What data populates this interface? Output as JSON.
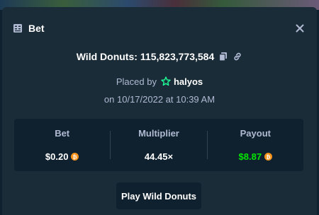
{
  "modal": {
    "title": "Bet",
    "close_icon": "close-icon"
  },
  "game": {
    "name": "Wild Donuts",
    "separator": ":",
    "bet_id": "115,823,773,584",
    "copy_icon": "copy-icon",
    "link_icon": "link-icon"
  },
  "placed": {
    "prefix": "Placed by",
    "user_icon": "star-badge-icon",
    "username": "halyos",
    "datetime": "on 10/17/2022 at 10:39 AM"
  },
  "stats": {
    "bet": {
      "label": "Bet",
      "value": "$0.20",
      "currency_icon": "bitcoin-icon"
    },
    "multiplier": {
      "label": "Multiplier",
      "value": "44.45×"
    },
    "payout": {
      "label": "Payout",
      "value": "$8.87",
      "currency_icon": "bitcoin-icon"
    }
  },
  "actions": {
    "play_label": "Play Wild Donuts"
  },
  "colors": {
    "background": "#0f212e",
    "panel": "#1a2c38",
    "muted_text": "#b1bad3",
    "payout_green": "#00e701",
    "coin_orange": "#f7931a",
    "username_icon": "#1fff98"
  }
}
